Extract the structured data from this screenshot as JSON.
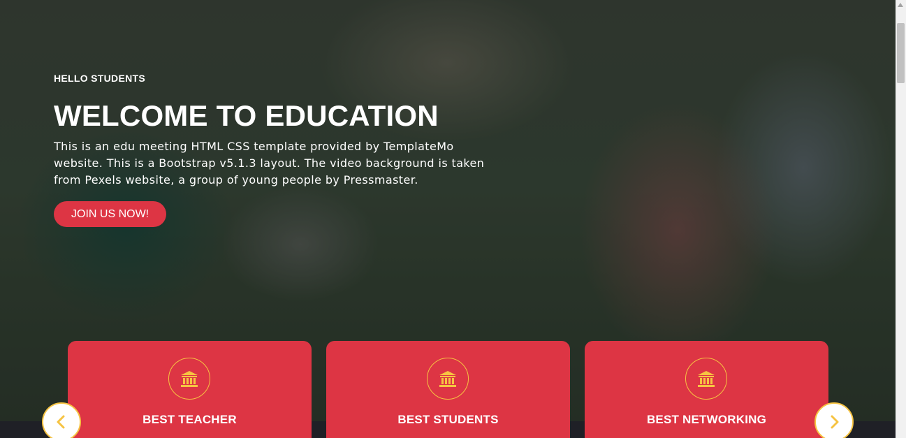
{
  "hero": {
    "eyebrow": "HELLO STUDENTS",
    "title": "WELCOME TO EDUCATION",
    "description": "This is an edu meeting HTML CSS template provided by TemplateMo website. This is a Bootstrap v5.1.3 layout. The video background is taken from Pexels website, a group of young people by Pressmaster.",
    "cta_label": "JOIN US NOW!"
  },
  "services": [
    {
      "title": "BEST TEACHER",
      "icon": "bank-icon"
    },
    {
      "title": "BEST STUDENTS",
      "icon": "bank-icon"
    },
    {
      "title": "BEST NETWORKING",
      "icon": "bank-icon"
    }
  ],
  "carousel": {
    "prev_icon": "chevron-left-icon",
    "next_icon": "chevron-right-icon"
  },
  "colors": {
    "accent": "#dd3544",
    "icon": "#f6c342",
    "text": "#ffffff"
  }
}
